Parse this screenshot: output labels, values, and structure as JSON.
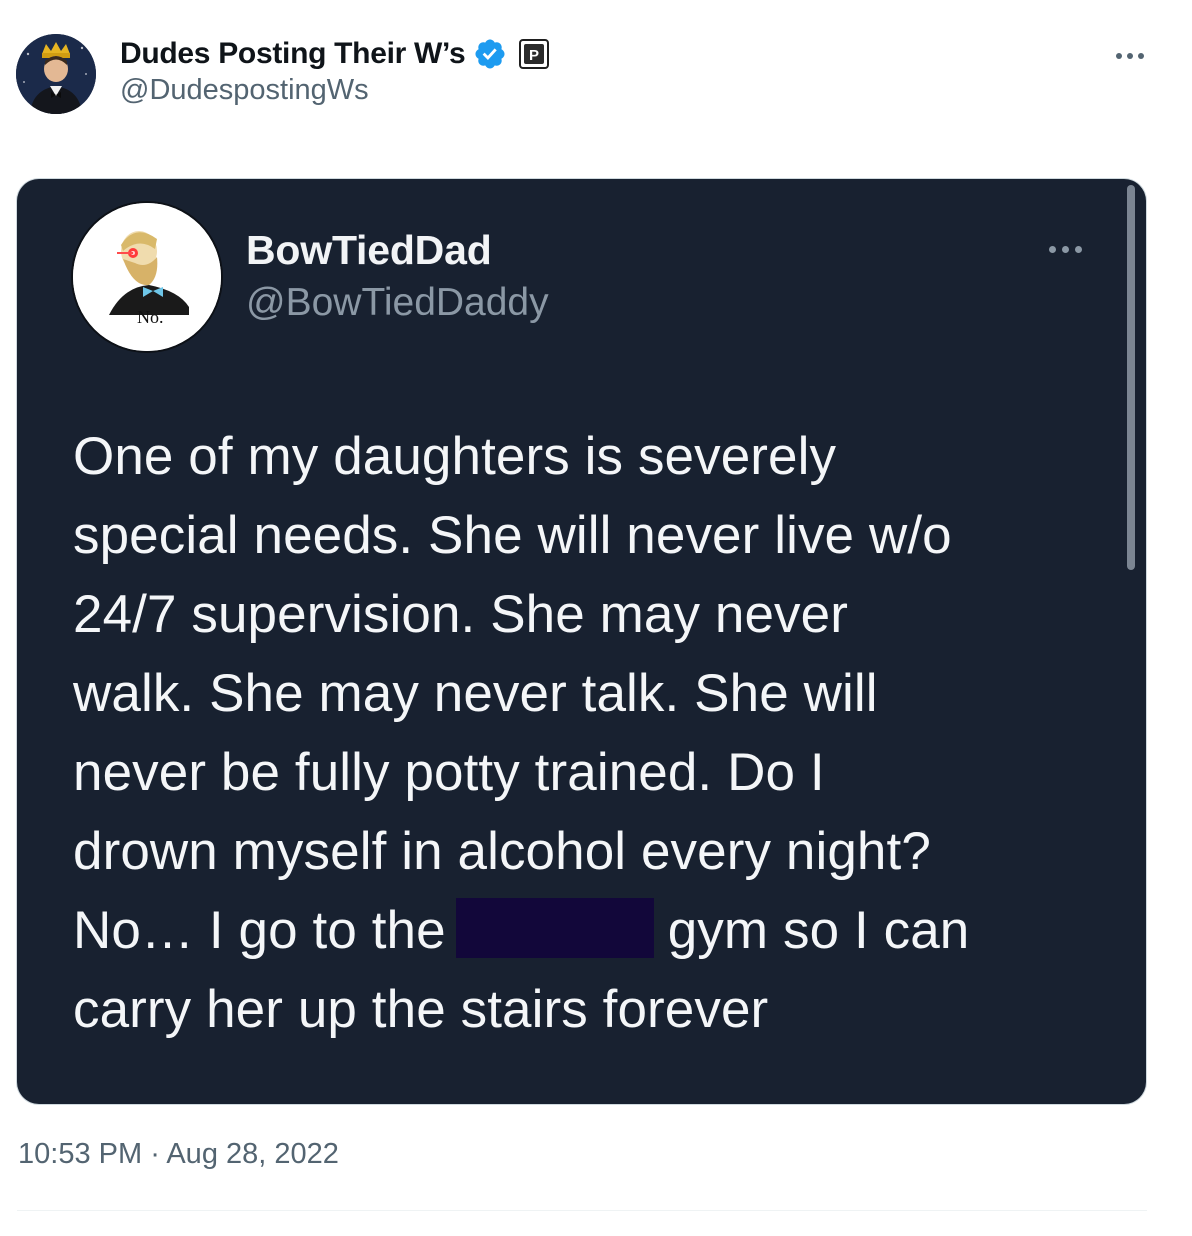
{
  "tweet": {
    "author": {
      "display_name": "Dudes Posting Their W’s",
      "handle": "@DudespostingWs",
      "verified_icon": "verified-badge-icon",
      "affiliate_icon": "affiliate-badge-icon",
      "accent_color": "#1d9bf0"
    },
    "more_icon": "more-horizontal-icon",
    "timestamp": {
      "time": "10:53 PM",
      "separator": "·",
      "date": "Aug 28, 2022"
    }
  },
  "embedded_tweet": {
    "display_name": "BowTiedDad",
    "handle": "@BowTiedDaddy",
    "avatar_caption": "No.",
    "more_icon": "more-horizontal-icon",
    "background_color": "#182130",
    "text_lines": [
      "One of my daughters is severely",
      "special needs. She will never live w/o",
      "24/7 supervision. She may never",
      "walk. She may never talk. She will",
      "never be fully potty trained. Do I",
      "drown myself in alcohol every night?",
      "No… I go to the",
      "gym so I can",
      "carry her up the stairs forever"
    ]
  }
}
